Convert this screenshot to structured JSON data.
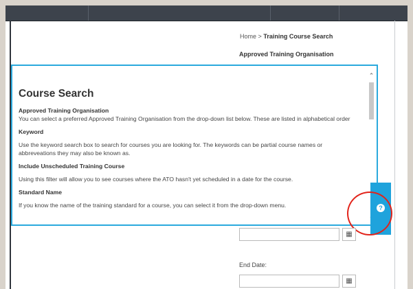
{
  "breadcrumb": {
    "home": "Home",
    "separator": ">",
    "current": "Training Course Search"
  },
  "form": {
    "ato_label": "Approved Training Organisation",
    "end_date_label": "End Date:",
    "calendar_icon": "calendar-icon"
  },
  "help_modal": {
    "title": "Course Search",
    "sections": [
      {
        "heading": "Approved Training Organisation",
        "text": "You can select a preferred Approved Training Organisation from the drop-down list below. These are listed in alphabetical order"
      },
      {
        "heading": "Keyword",
        "text": "Use the keyword search box to search for courses you are looking for. The keywords can be partial course names or abbreveations they may also be known as."
      },
      {
        "heading": "Include Unscheduled Training Course",
        "text": "Using this filter will allow you to see courses where the ATO hasn't yet scheduled in a date for the course."
      },
      {
        "heading": "Standard Name",
        "text": "If you know the name of the training standard for a course, you can select it from the drop-down menu."
      }
    ]
  },
  "help_tab": {
    "icon": "help-icon",
    "glyph": "?"
  },
  "colors": {
    "accent": "#1fa3dc",
    "highlight": "#e2231a",
    "topbar": "#3d434c"
  }
}
